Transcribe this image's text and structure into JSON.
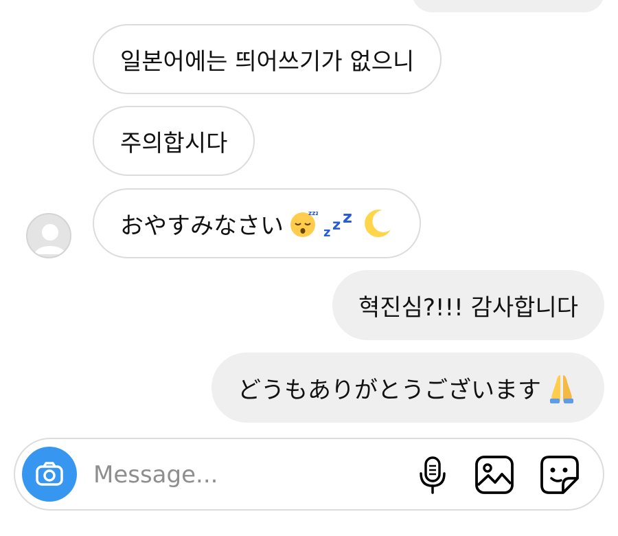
{
  "messages": [
    {
      "text": "일본어에는 띄어쓰기가 없으니"
    },
    {
      "text": "주의합시다"
    },
    {
      "text": "おやすみなさい"
    },
    {
      "text": "혁진심?!!! 감사합니다"
    },
    {
      "text": "どうもありがとうございます"
    }
  ],
  "emojis": {
    "sleeping": "sleeping-face-emoji",
    "zzz": "zzz-emoji",
    "moon": "crescent-moon-emoji",
    "pray": "folded-hands-emoji"
  },
  "composer": {
    "placeholder": "Message..."
  },
  "icons": [
    "camera-icon",
    "microphone-icon",
    "gallery-icon",
    "sticker-icon"
  ],
  "colors": {
    "accent": "#3797f0",
    "outgoing_bubble": "#efefef",
    "incoming_border": "#dcdcdc",
    "zzz": "#2a5bd7"
  }
}
